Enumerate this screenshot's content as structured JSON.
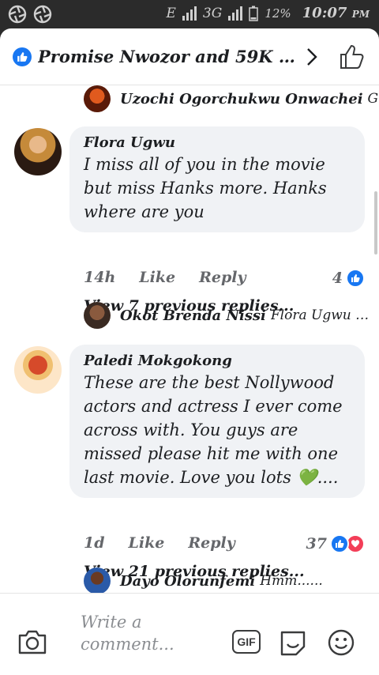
{
  "status_bar": {
    "network_e": "E",
    "network_3g": "3G",
    "battery": "12%",
    "time": "10:07",
    "ampm": "PM"
  },
  "header": {
    "title": "Promise Nwozor and 59K oth...",
    "like_badge_icon": "thumbs-up-badge-icon",
    "chevron_icon": "chevron-right-icon",
    "like_icon": "thumbs-up-outline-icon"
  },
  "replies": [
    {
      "name": "Uzochi Ogorchukwu Onwachei",
      "text": "G..."
    },
    {
      "name": "Okot Brenda Nissi",
      "text": "Flora Ugwu I..."
    },
    {
      "name": "Dayo Olorunfemi",
      "text": "Hmm......"
    }
  ],
  "comments": [
    {
      "name": "Flora Ugwu",
      "text": "I miss all of you in the movie but miss Hanks more. Hanks where are you",
      "time": "14h",
      "like": "Like",
      "reply": "Reply",
      "reaction_count": "4",
      "view_replies": "View 7 previous replies..."
    },
    {
      "name": "Paledi Mokgokong",
      "text": "These are the best Nollywood actors and actress I ever come across with. You guys are missed please hit me with one last movie. Love you lots 💚....",
      "time": "1d",
      "like": "Like",
      "reply": "Reply",
      "reaction_count": "37",
      "view_replies": "View 21 previous replies..."
    }
  ],
  "composer": {
    "placeholder": "Write a comment...",
    "gif_label": "GIF",
    "camera_icon": "camera-icon",
    "sticker_icon": "sticker-icon",
    "emoji_icon": "smiley-icon"
  },
  "colors": {
    "brand_blue": "#1877f2",
    "love_red": "#f33e58",
    "bubble_bg": "#f0f2f5",
    "meta_gray": "#65676b"
  }
}
